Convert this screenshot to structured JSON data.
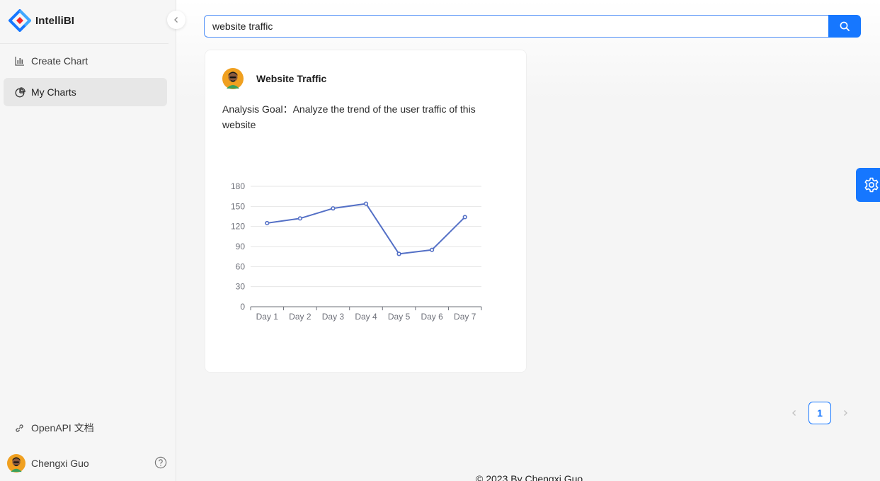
{
  "app": {
    "name": "IntelliBI"
  },
  "sidebar": {
    "menu": [
      {
        "label": "Create Chart",
        "icon": "bar-chart-icon",
        "active": false
      },
      {
        "label": "My Charts",
        "icon": "pie-chart-icon",
        "active": true
      }
    ],
    "openapi_label": "OpenAPI 文档",
    "user_name": "Chengxi Guo"
  },
  "search": {
    "value": "website traffic"
  },
  "card": {
    "title": "Website Traffic",
    "goal": "Analysis Goal：Analyze the trend of the user traffic of this website"
  },
  "chart_data": {
    "type": "line",
    "categories": [
      "Day 1",
      "Day 2",
      "Day 3",
      "Day 4",
      "Day 5",
      "Day 6",
      "Day 7"
    ],
    "values": [
      125,
      132,
      147,
      154,
      79,
      85,
      134
    ],
    "ylim": [
      0,
      180
    ],
    "yticks": [
      0,
      30,
      60,
      90,
      120,
      150,
      180
    ],
    "grid": true,
    "color": "#5470c6"
  },
  "pagination": {
    "current": "1"
  },
  "footer": {
    "text": "© 2023 By Chengxi Guo"
  },
  "colors": {
    "primary": "#1677ff"
  }
}
